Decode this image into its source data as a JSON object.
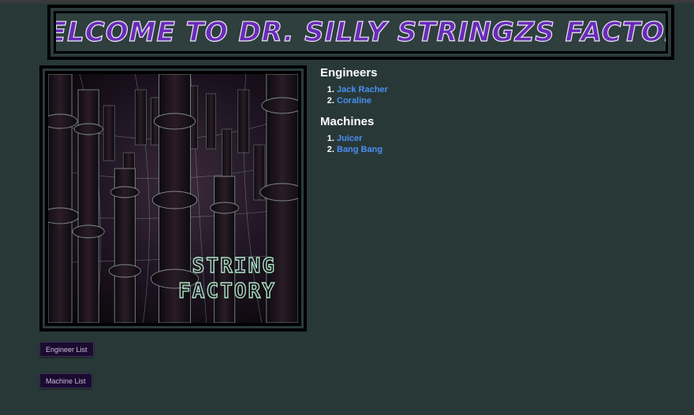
{
  "banner": {
    "title": "Welcome to Dr. Silly Stringzs Factory"
  },
  "image": {
    "caption_line1": "STRING",
    "caption_line2": "FACTORY"
  },
  "engineers": {
    "heading": "Engineers",
    "items": [
      "Jack Racher",
      "Coraline"
    ]
  },
  "machines": {
    "heading": "Machines",
    "items": [
      "Juicer",
      "Bang Bang"
    ]
  },
  "buttons": {
    "engineer_list": "Engineer List",
    "machine_list": "Machine List"
  },
  "colors": {
    "background": "#283837",
    "banner_text": "#6a2bb8",
    "link": "#4a8ff0",
    "button_bg": "#1b0b30"
  }
}
